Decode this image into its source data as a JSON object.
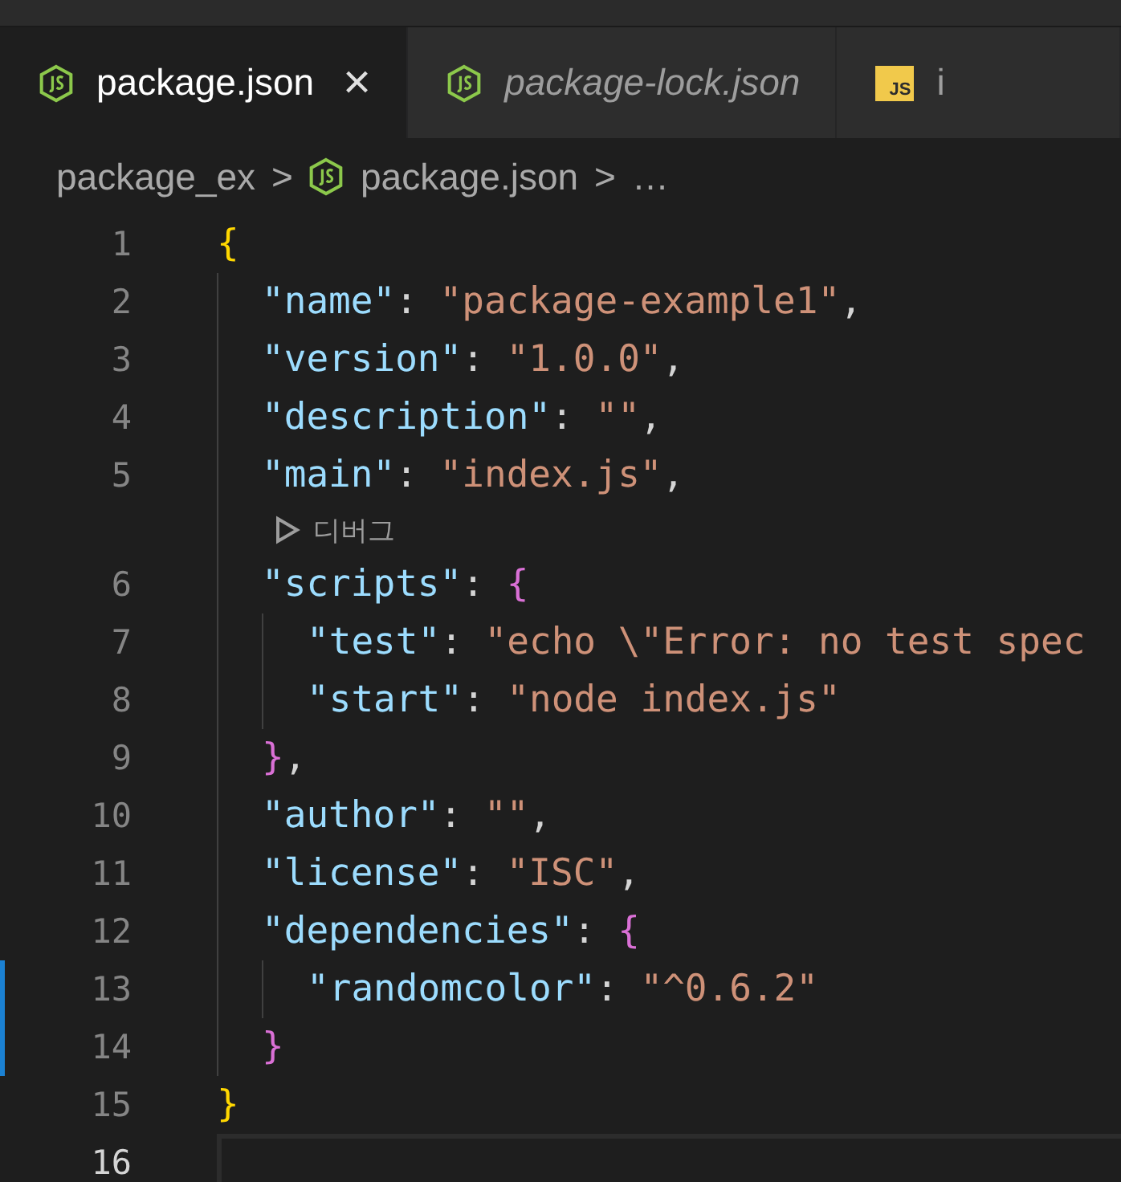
{
  "tabs": [
    {
      "label": "package.json",
      "kind": "node",
      "selected": true,
      "preview": false,
      "close": "×"
    },
    {
      "label": "package-lock.json",
      "kind": "node",
      "selected": false,
      "preview": true
    },
    {
      "label": "i",
      "kind": "js",
      "icon_text": "JS",
      "selected": false,
      "preview": false
    }
  ],
  "breadcrumb": [
    {
      "label": "package_ex"
    },
    {
      "label": "package.json",
      "kind": "node"
    },
    {
      "label": "…"
    }
  ],
  "breadcrumb_separator": ">",
  "lines": [
    {
      "kind": "code",
      "number": "1",
      "current": false,
      "modified": false,
      "tokens": [
        {
          "kind": "brace1",
          "text": "{"
        }
      ],
      "children": [
        {
          "kind": "code",
          "number": "2",
          "current": false,
          "modified": false,
          "tokens": [
            {
              "kind": "key",
              "text": "\"name\""
            },
            {
              "kind": "punct",
              "text": ": "
            },
            {
              "kind": "string",
              "text": "\"package-example1\""
            },
            {
              "kind": "punct",
              "text": ","
            }
          ]
        },
        {
          "kind": "code",
          "number": "3",
          "current": false,
          "modified": false,
          "tokens": [
            {
              "kind": "key",
              "text": "\"version\""
            },
            {
              "kind": "punct",
              "text": ": "
            },
            {
              "kind": "string",
              "text": "\"1.0.0\""
            },
            {
              "kind": "punct",
              "text": ","
            }
          ]
        },
        {
          "kind": "code",
          "number": "4",
          "current": false,
          "modified": false,
          "tokens": [
            {
              "kind": "key",
              "text": "\"description\""
            },
            {
              "kind": "punct",
              "text": ": "
            },
            {
              "kind": "string",
              "text": "\"\""
            },
            {
              "kind": "punct",
              "text": ","
            }
          ]
        },
        {
          "kind": "code",
          "number": "5",
          "current": false,
          "modified": false,
          "tokens": [
            {
              "kind": "key",
              "text": "\"main\""
            },
            {
              "kind": "punct",
              "text": ": "
            },
            {
              "kind": "string",
              "text": "\"index.js\""
            },
            {
              "kind": "punct",
              "text": ","
            }
          ]
        },
        {
          "kind": "codelens",
          "label": "디버그"
        },
        {
          "kind": "code",
          "number": "6",
          "current": false,
          "modified": false,
          "tokens": [
            {
              "kind": "key",
              "text": "\"scripts\""
            },
            {
              "kind": "punct",
              "text": ": "
            },
            {
              "kind": "brace2",
              "text": "{"
            }
          ],
          "children": [
            {
              "kind": "code",
              "number": "7",
              "current": false,
              "modified": false,
              "tokens": [
                {
                  "kind": "key",
                  "text": "\"test\""
                },
                {
                  "kind": "punct",
                  "text": ": "
                },
                {
                  "kind": "string",
                  "text": "\"echo \\\"Error: no test spec"
                }
              ]
            },
            {
              "kind": "code",
              "number": "8",
              "current": false,
              "modified": false,
              "tokens": [
                {
                  "kind": "key",
                  "text": "\"start\""
                },
                {
                  "kind": "punct",
                  "text": ": "
                },
                {
                  "kind": "string",
                  "text": "\"node index.js\""
                }
              ]
            }
          ]
        },
        {
          "kind": "code",
          "number": "9",
          "current": false,
          "modified": false,
          "tokens": [
            {
              "kind": "brace2",
              "text": "}"
            },
            {
              "kind": "punct",
              "text": ","
            }
          ]
        },
        {
          "kind": "code",
          "number": "10",
          "current": false,
          "modified": false,
          "tokens": [
            {
              "kind": "key",
              "text": "\"author\""
            },
            {
              "kind": "punct",
              "text": ": "
            },
            {
              "kind": "string",
              "text": "\"\""
            },
            {
              "kind": "punct",
              "text": ","
            }
          ]
        },
        {
          "kind": "code",
          "number": "11",
          "current": false,
          "modified": false,
          "tokens": [
            {
              "kind": "key",
              "text": "\"license\""
            },
            {
              "kind": "punct",
              "text": ": "
            },
            {
              "kind": "string",
              "text": "\"ISC\""
            },
            {
              "kind": "punct",
              "text": ","
            }
          ]
        },
        {
          "kind": "code",
          "number": "12",
          "current": false,
          "modified": false,
          "tokens": [
            {
              "kind": "key",
              "text": "\"dependencies\""
            },
            {
              "kind": "punct",
              "text": ": "
            },
            {
              "kind": "brace2",
              "text": "{"
            }
          ],
          "children": [
            {
              "kind": "code",
              "number": "13",
              "current": false,
              "modified": true,
              "tokens": [
                {
                  "kind": "key",
                  "text": "\"randomcolor\""
                },
                {
                  "kind": "punct",
                  "text": ": "
                },
                {
                  "kind": "string",
                  "text": "\"^0.6.2\""
                }
              ]
            }
          ]
        },
        {
          "kind": "code",
          "number": "14",
          "current": false,
          "modified": true,
          "tokens": [
            {
              "kind": "brace2",
              "text": "}"
            }
          ]
        }
      ]
    },
    {
      "kind": "code",
      "number": "15",
      "current": false,
      "modified": false,
      "tokens": [
        {
          "kind": "brace1",
          "text": "}"
        }
      ]
    },
    {
      "kind": "code",
      "number": "16",
      "current": true,
      "modified": false
    }
  ]
}
